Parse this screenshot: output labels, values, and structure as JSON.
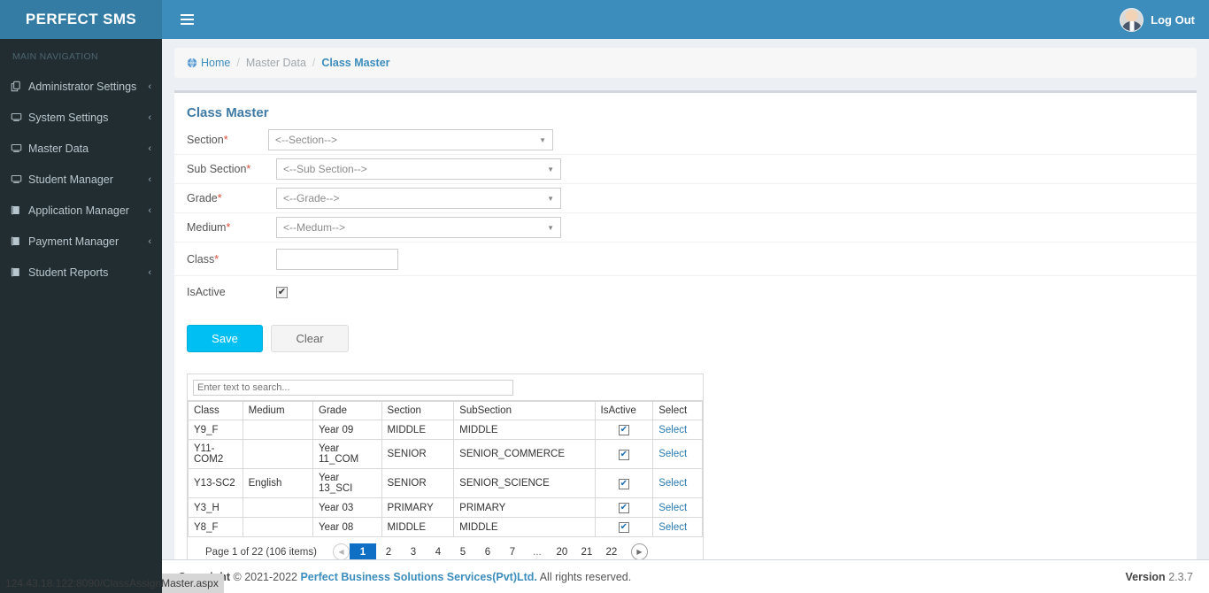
{
  "brand": {
    "name": "PERFECT SMS"
  },
  "topbar": {
    "menu_icon": "hamburger-icon",
    "logout_label": "Log Out",
    "avatar_icon": "user-avatar"
  },
  "sidebar": {
    "heading": "MAIN NAVIGATION",
    "items": [
      {
        "label": "Administrator Settings",
        "icon": "copy-files-icon",
        "caret": "‹"
      },
      {
        "label": "System Settings",
        "icon": "desktop-icon",
        "caret": "‹"
      },
      {
        "label": "Master Data",
        "icon": "desktop-icon",
        "caret": "‹"
      },
      {
        "label": "Student Manager",
        "icon": "desktop-icon",
        "caret": "‹"
      },
      {
        "label": "Application Manager",
        "icon": "book-icon",
        "caret": "‹"
      },
      {
        "label": "Payment Manager",
        "icon": "book-icon",
        "caret": "‹"
      },
      {
        "label": "Student Reports",
        "icon": "book-icon",
        "caret": "‹"
      }
    ]
  },
  "breadcrumb": {
    "home": "Home",
    "home_icon": "dashboard-globe-icon",
    "sep": "/",
    "parent": "Master Data",
    "current": "Class Master"
  },
  "page": {
    "title": "Class Master"
  },
  "form": {
    "fields": [
      {
        "label": "Section",
        "required": "*",
        "value": "<--Section-->",
        "type": "select"
      },
      {
        "label": "Sub Section",
        "required": "*",
        "value": "<--Sub Section-->",
        "type": "select"
      },
      {
        "label": "Grade",
        "required": "*",
        "value": "<--Grade-->",
        "type": "select"
      },
      {
        "label": "Medium",
        "required": "*",
        "value": "<--Medum-->",
        "type": "select"
      }
    ],
    "class_label": "Class",
    "class_required": "*",
    "class_value": "",
    "isactive_label": "IsActive",
    "isactive_checked": "✔",
    "save_label": "Save",
    "clear_label": "Clear"
  },
  "grid": {
    "search_placeholder": "Enter text to search...",
    "search_value": "",
    "columns": [
      "Class",
      "Medium",
      "Grade",
      "Section",
      "SubSection",
      "IsActive",
      "Select"
    ],
    "check_glyph": "✔",
    "select_label": "Select",
    "rows": [
      {
        "class": "Y9_F",
        "medium": "",
        "grade": "Year 09",
        "section": "MIDDLE",
        "subsection": "MIDDLE"
      },
      {
        "class": "Y11-COM2",
        "medium": "",
        "grade": "Year 11_COM",
        "section": "SENIOR",
        "subsection": "SENIOR_COMMERCE"
      },
      {
        "class": "Y13-SC2",
        "medium": "English",
        "grade": "Year 13_SCI",
        "section": "SENIOR",
        "subsection": "SENIOR_SCIENCE"
      },
      {
        "class": "Y3_H",
        "medium": "",
        "grade": "Year 03",
        "section": "PRIMARY",
        "subsection": "PRIMARY"
      },
      {
        "class": "Y8_F",
        "medium": "",
        "grade": "Year 08",
        "section": "MIDDLE",
        "subsection": "MIDDLE"
      }
    ],
    "pager": {
      "info": "Page 1 of 22 (106 items)",
      "prev_glyph": "◀",
      "next_glyph": "▶",
      "pages": [
        "1",
        "2",
        "3",
        "4",
        "5",
        "6",
        "7",
        "...",
        "20",
        "21",
        "22"
      ],
      "active_page": "1"
    }
  },
  "footer": {
    "copyright_bold": "Copyright",
    "copyright_text": "© 2021-2022",
    "company": "Perfect Business Solutions Services(Pvt)Ltd.",
    "rights": "All rights reserved.",
    "version_label": "Version",
    "version_number": "2.3.7"
  },
  "statusbar": {
    "url": "124.43.18.122:8090/ClassAssignMaster.aspx"
  },
  "colors": {
    "brand_dark": "#357ca5",
    "navbar": "#3c8dbc",
    "sidebar": "#222d32",
    "accent_link": "#3c8dbc",
    "save_button": "#00bff3",
    "page_active": "#0f6fc5",
    "required": "#dd4b39",
    "body_bg": "#ecf0f5"
  }
}
